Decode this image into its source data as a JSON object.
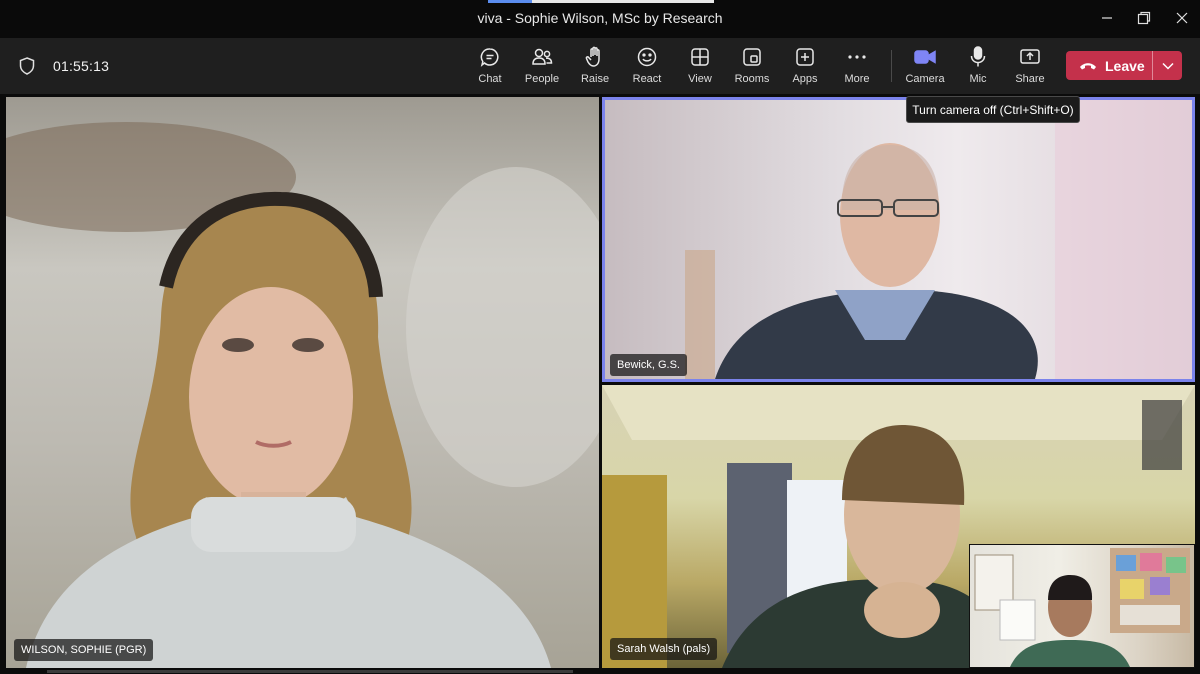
{
  "window": {
    "title": "viva - Sophie Wilson, MSc by Research"
  },
  "meeting": {
    "timer": "01:55:13"
  },
  "toolbar": {
    "buttons": [
      {
        "label": "Chat",
        "icon": "chat-icon"
      },
      {
        "label": "People",
        "icon": "people-icon"
      },
      {
        "label": "Raise",
        "icon": "raise-hand-icon"
      },
      {
        "label": "React",
        "icon": "react-icon"
      },
      {
        "label": "View",
        "icon": "view-icon"
      },
      {
        "label": "Rooms",
        "icon": "rooms-icon"
      },
      {
        "label": "Apps",
        "icon": "apps-icon"
      },
      {
        "label": "More",
        "icon": "more-icon"
      },
      {
        "label": "Camera",
        "icon": "camera-icon"
      },
      {
        "label": "Mic",
        "icon": "mic-icon"
      },
      {
        "label": "Share",
        "icon": "share-icon"
      }
    ],
    "leave_label": "Leave"
  },
  "tooltip": {
    "text": "Turn camera off (Ctrl+Shift+O)"
  },
  "participants": [
    {
      "name": "WILSON, SOPHIE (PGR)"
    },
    {
      "name": "Bewick, G.S."
    },
    {
      "name": "Sarah Walsh (pals)"
    },
    {
      "name": ""
    }
  ],
  "colors": {
    "leave": "#c4314b",
    "active_speaker_border": "#7b83eb",
    "camera_accent": "#7f85f5"
  }
}
